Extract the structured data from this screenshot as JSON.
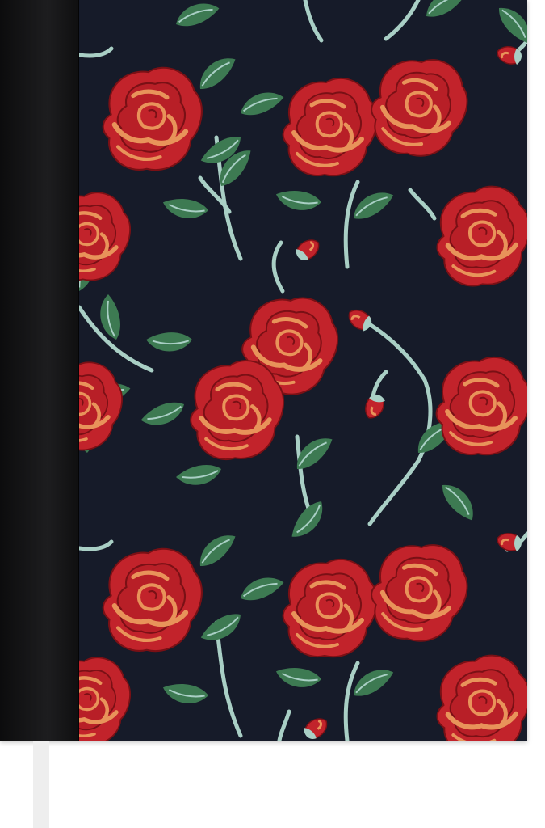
{
  "image": {
    "subject": "notebook-with-rose-pattern-cover",
    "cover_background": "#161b29",
    "spine_color": "#151517",
    "rose_red": "#c2232b",
    "rose_highlight": "#e8935a",
    "rose_outline": "#7a1015",
    "leaf_green": "#3d7a52",
    "stem_color": "#a9cfc5",
    "bookmark_color": "#eeeeee"
  }
}
